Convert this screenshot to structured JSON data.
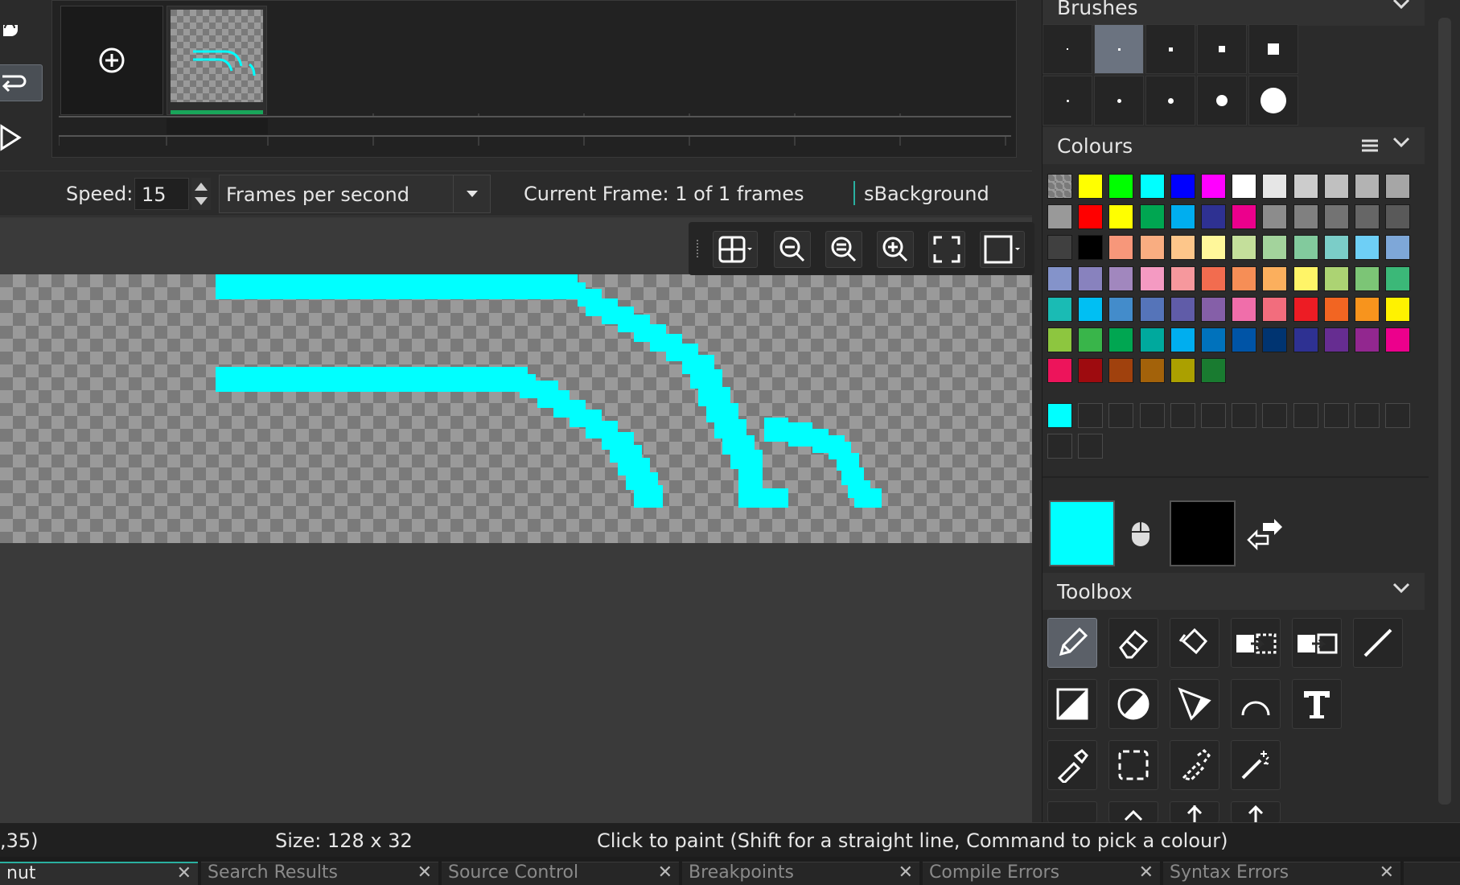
{
  "speedbar": {
    "speed_label": "Speed:",
    "speed_value": "15",
    "fps_option": "Frames per second",
    "current_frame": "Current Frame: 1 of 1 frames",
    "sprite_name": "sBackground"
  },
  "panels": {
    "brushes": "Brushes",
    "colours": "Colours",
    "toolbox": "Toolbox"
  },
  "colours": {
    "primary": "#00ffff",
    "secondary": "#000000",
    "palette": [
      "transparent",
      "#ffff00",
      "#00ff00",
      "#00ffff",
      "#0000ff",
      "#ff00ff",
      "#ffffff",
      "#e6e6e6",
      "#cccccc",
      "#c0c0c0",
      "#b3b3b3",
      "#a6a6a6",
      "#999999",
      "#ff0000",
      "#ffff00",
      "#00a651",
      "#00aeef",
      "#2e3192",
      "#ec008c",
      "#8c8c8c",
      "#808080",
      "#737373",
      "#666666",
      "#595959",
      "#404040",
      "#000000",
      "#f7977a",
      "#f9ad81",
      "#fdc68a",
      "#fff79a",
      "#c4df9b",
      "#a3d39c",
      "#82ca9d",
      "#7bcdc8",
      "#6ecff6",
      "#7ea7d8",
      "#8493ca",
      "#8882be",
      "#a187be",
      "#f49ac2",
      "#f6989d",
      "#f26c4f",
      "#f68e56",
      "#fbaf5d",
      "#fff467",
      "#acd373",
      "#7cc576",
      "#3bb878",
      "#1abbb4",
      "#00bff3",
      "#438ccb",
      "#5574b9",
      "#605ca8",
      "#855fa8",
      "#f06eaa",
      "#f26d7d",
      "#ed1c24",
      "#f26522",
      "#f7941d",
      "#fff200",
      "#8dc63f",
      "#39b54a",
      "#00a651",
      "#00a99d",
      "#00aeef",
      "#0072bc",
      "#0054a6",
      "#003471",
      "#2e3192",
      "#662d91",
      "#92278f",
      "#ec008c",
      "#ed145b",
      "#9e0b0f",
      "#a0410d",
      "#a3620a",
      "#aba000",
      "#197b30"
    ],
    "custom": [
      "#00ffff",
      "",
      "",
      "",
      "",
      "",
      "",
      "",
      "",
      "",
      "",
      "",
      "",
      ""
    ]
  },
  "status": {
    "coords": ",35)",
    "size": "Size: 128 x 32",
    "hint": "Click to paint (Shift for a straight line, Command to pick a colour)"
  },
  "bottom_tabs": [
    "nut",
    "Search Results",
    "Source Control",
    "Breakpoints",
    "Compile Errors",
    "Syntax Errors"
  ],
  "icons": {
    "tools": [
      "pencil-icon",
      "eraser-icon",
      "fill-bucket-icon",
      "select-move-icon",
      "paste-move-icon",
      "line-icon",
      "rectangle-icon",
      "ellipse-icon",
      "polygon-icon",
      "arc-icon",
      "text-icon",
      "colour-picker-icon",
      "rectangle-select-icon",
      "lasso-select-icon",
      "magic-wand-icon"
    ]
  }
}
